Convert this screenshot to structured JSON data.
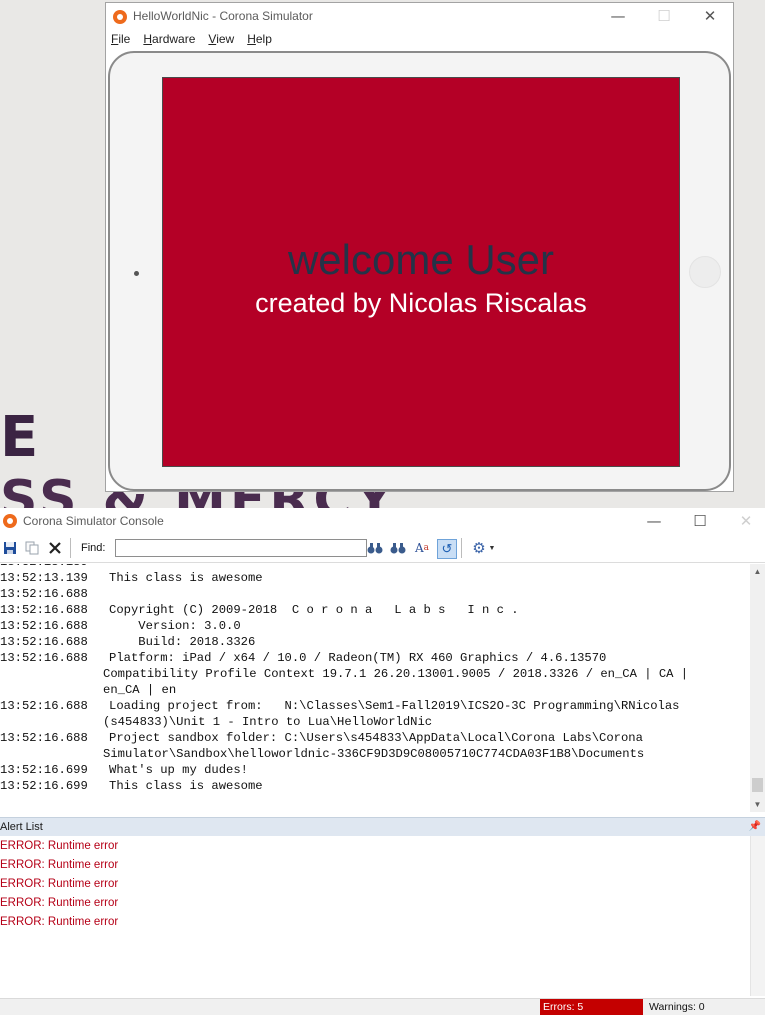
{
  "desktop": {
    "wallpaper_line_1": "E",
    "wallpaper_line_2": "SS & MERCY"
  },
  "simulator": {
    "title": "HelloWorldNic - Corona Simulator",
    "controls": {
      "minimize": "—",
      "maximize": "☐",
      "close": "✕"
    },
    "menu": [
      "File",
      "Hardware",
      "View",
      "Help"
    ],
    "device": {
      "screen_color": "#b40026",
      "welcome_text": "welcome User",
      "credit_text": "created by Nicolas Riscalas"
    }
  },
  "console": {
    "title": "Corona Simulator Console",
    "controls": {
      "minimize": "—",
      "maximize": "☐",
      "close": "✕"
    },
    "toolbar": {
      "find_label": "Find:",
      "find_value": ""
    },
    "log": [
      {
        "time": "13:52:13.139",
        "msg": "This class is awesome"
      },
      {
        "time": "13:52:16.688",
        "msg": ""
      },
      {
        "time": "13:52:16.688",
        "msg": "Copyright (C) 2009-2018  C o r o n a   L a b s   I n c ."
      },
      {
        "time": "13:52:16.688",
        "msg": "    Version: 3.0.0"
      },
      {
        "time": "13:52:16.688",
        "msg": "    Build: 2018.3326"
      },
      {
        "time": "13:52:16.688",
        "msg": "Platform: iPad / x64 / 10.0 / Radeon(TM) RX 460 Graphics / 4.6.13570"
      },
      {
        "time": "",
        "msg": "Compatibility Profile Context 19.7.1 26.20.13001.9005 / 2018.3326 / en_CA | CA |"
      },
      {
        "time": "",
        "msg": "en_CA | en"
      },
      {
        "time": "13:52:16.688",
        "msg": "Loading project from:   N:\\Classes\\Sem1-Fall2019\\ICS2O-3C Programming\\RNicolas"
      },
      {
        "time": "",
        "msg": "(s454833)\\Unit 1 - Intro to Lua\\HelloWorldNic"
      },
      {
        "time": "13:52:16.688",
        "msg": "Project sandbox folder: C:\\Users\\s454833\\AppData\\Local\\Corona Labs\\Corona"
      },
      {
        "time": "",
        "msg": "Simulator\\Sandbox\\helloworldnic-336CF9D3D9C08005710C774CDA03F1B8\\Documents"
      },
      {
        "time": "13:52:16.699",
        "msg": "What's up my dudes!"
      },
      {
        "time": "13:52:16.699",
        "msg": "This class is awesome"
      }
    ],
    "alert_list": {
      "title": "Alert List",
      "items": [
        "ERROR: Runtime error",
        "ERROR: Runtime error",
        "ERROR: Runtime error",
        "ERROR: Runtime error",
        "ERROR: Runtime error"
      ]
    },
    "status": {
      "errors": "Errors: 5",
      "warnings": "Warnings: 0",
      "error_color": "#c40000"
    }
  }
}
